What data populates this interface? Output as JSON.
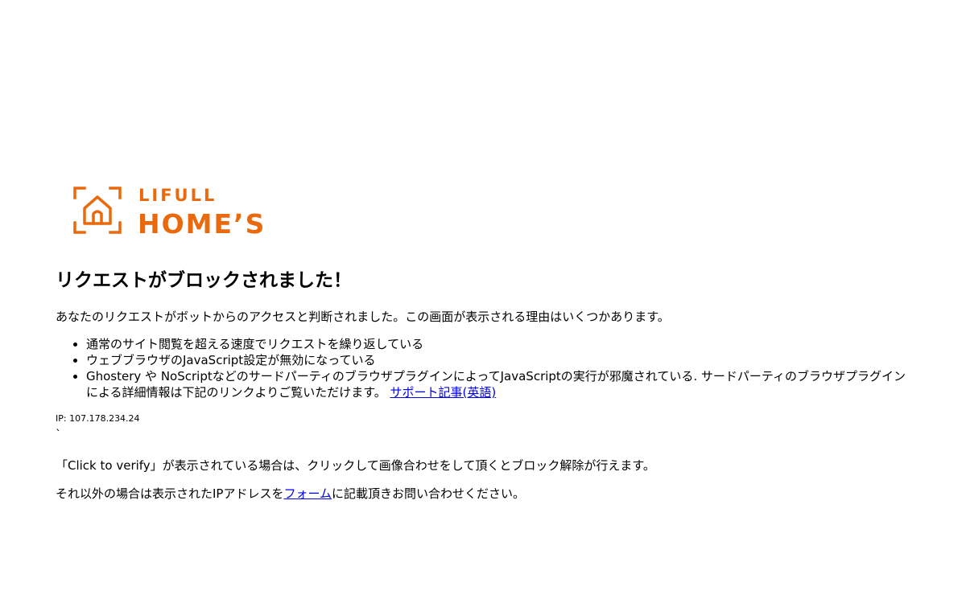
{
  "brand": {
    "logo_top": "LIFULL",
    "logo_main": "HOME’S",
    "color": "#e9690c"
  },
  "main": {
    "title": "リクエストがブロックされました！",
    "lead": "あなたのリクエストがボットからのアクセスと判断されました。この画面が表示される理由はいくつかあります。",
    "reasons": [
      "通常のサイト閲覧を超える速度でリクエストを繰り返している",
      "ウェブブラウザのJavaScript設定が無効になっている",
      "Ghostery や NoScriptなどのサードパーティのブラウザプラグインによってJavaScriptの実行が邪魔されている. サードパーティのブラウザプラグインによる詳細情報は下記のリンクよりご覧いただけます。"
    ],
    "support_link": "サポート記事(英語)",
    "ip": "IP: 107.178.234.24",
    "tick": "`",
    "verify_note": "「Click to verify」が表示されている場合は、クリックして画像合わせをして頂くとブロック解除が行えます。",
    "contact_prefix": "それ以外の場合は表示されたIPアドレスを",
    "contact_link": "フォーム",
    "contact_suffix": "に記載頂きお問い合わせください。"
  }
}
